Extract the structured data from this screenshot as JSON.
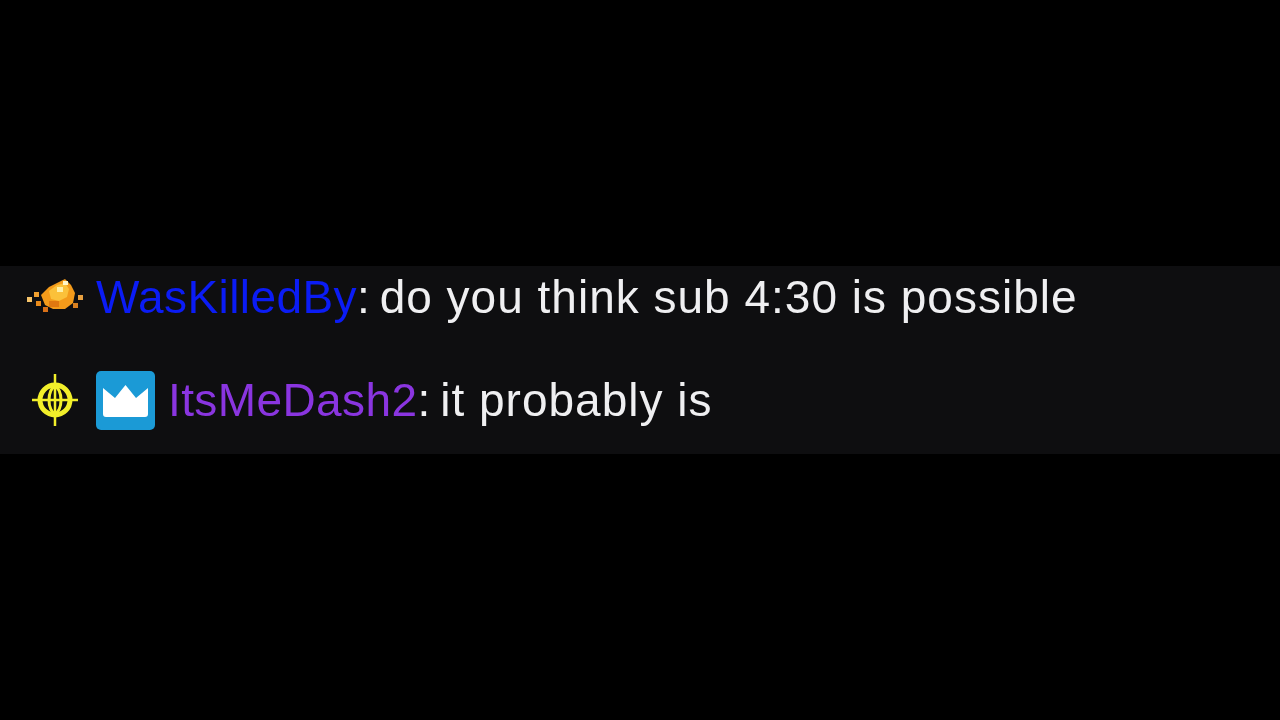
{
  "chat": {
    "messages": [
      {
        "badges": [
          {
            "kind": "nugget"
          }
        ],
        "username": "WasKilledBy",
        "color": "#0b1cf5",
        "separator": ":",
        "text": "do you think sub 4:30 is possible"
      },
      {
        "badges": [
          {
            "kind": "crosshair"
          },
          {
            "kind": "crown"
          }
        ],
        "username": "ItsMeDash2",
        "color": "#8a35e0",
        "separator": ":",
        "text": "it probably is"
      }
    ]
  }
}
